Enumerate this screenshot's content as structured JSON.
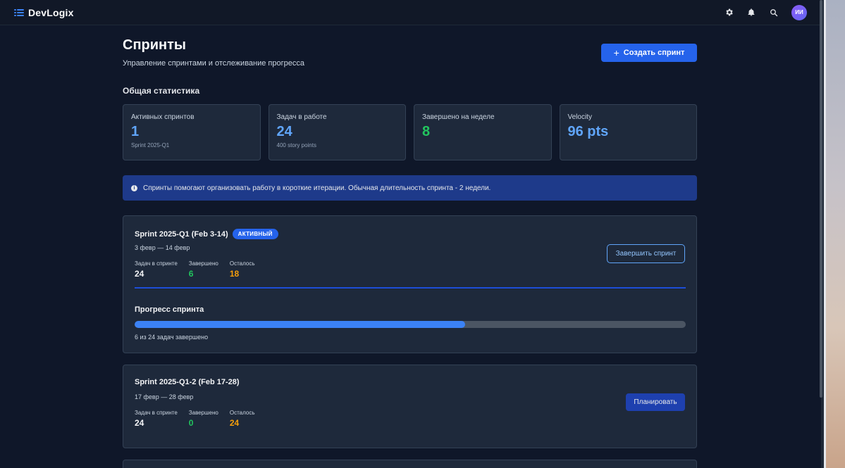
{
  "app": {
    "name": "DevLogix"
  },
  "header": {
    "icons": [
      "gear-icon",
      "bell-icon",
      "search-icon"
    ],
    "avatar_initials": "ИИ"
  },
  "page": {
    "title": "Спринты",
    "subtitle": "Управление спринтами и отслеживание прогресса",
    "create_button": "Создать спринт"
  },
  "stats": {
    "title": "Общая статистика",
    "cards": [
      {
        "label": "Активных спринтов",
        "value": "1",
        "sub": "Sprint 2025-Q1",
        "color": "#60a5fa"
      },
      {
        "label": "Задач в работе",
        "value": "24",
        "sub": "400 story points",
        "color": "#60a5fa"
      },
      {
        "label": "Завершено на неделе",
        "value": "8",
        "sub": "",
        "color": "#22c55e"
      },
      {
        "label": "Velocity",
        "value": "96 pts",
        "sub": "",
        "color": "#60a5fa"
      }
    ]
  },
  "info": {
    "text": "Спринты помогают организовать работу в короткие итерации. Обычная длительность спринта - 2 недели."
  },
  "sprints": [
    {
      "name": "Sprint 2025-Q1 (Feb 3-14)",
      "badge": "АКТИВНЫЙ",
      "dates": "3 февр — 14 февр",
      "metrics": [
        {
          "label": "Задач в спринте",
          "value": "24",
          "color": "#f3f4f6"
        },
        {
          "label": "Завершено",
          "value": "6",
          "color": "#22c55e"
        },
        {
          "label": "Осталось",
          "value": "18",
          "color": "#f59e0b"
        }
      ],
      "action": "Завершить спринт",
      "progress_title": "Прогресс спринта",
      "progress_percent": 60,
      "progress_text": "6 из 24 задач завершено"
    },
    {
      "name": "Sprint 2025-Q1-2 (Feb 17-28)",
      "dates": "17 февр — 28 февр",
      "metrics": [
        {
          "label": "Задач в спринте",
          "value": "24",
          "color": "#f3f4f6"
        },
        {
          "label": "Завершено",
          "value": "0",
          "color": "#22c55e"
        },
        {
          "label": "Осталось",
          "value": "24",
          "color": "#f59e0b"
        }
      ],
      "action": "Планировать"
    }
  ]
}
